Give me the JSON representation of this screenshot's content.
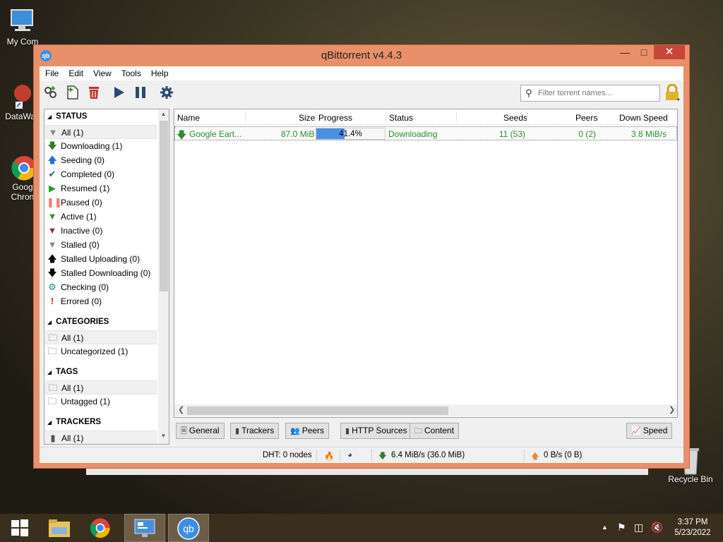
{
  "desktop": {
    "icons": [
      {
        "label": "My Computer",
        "visible": "My Com"
      },
      {
        "label": "DataWag",
        "visible": "DataWag"
      },
      {
        "label": "Google Chrome",
        "visible_line1": "Goog",
        "visible_line2": "Chron"
      },
      {
        "label": "Recycle Bin"
      }
    ]
  },
  "window": {
    "title": "qBittorrent v4.4.3",
    "app_icon_text": "qb",
    "controls": {
      "minimize": "🗕",
      "maximize": "🗖",
      "close": "✕"
    }
  },
  "menu": [
    "File",
    "Edit",
    "View",
    "Tools",
    "Help"
  ],
  "toolbar": {
    "search_placeholder": "Filter torrent names...",
    "icons": [
      "add-torrent-link-icon",
      "add-torrent-file-icon",
      "delete-icon",
      "resume-icon",
      "pause-icon",
      "options-gear-icon"
    ]
  },
  "sidebar": {
    "status_header": "STATUS",
    "status": [
      {
        "label": "All (1)",
        "icon": "funnel",
        "color": "#888888"
      },
      {
        "label": "Downloading (1)",
        "icon": "arrow-down",
        "color": "#2e7d32"
      },
      {
        "label": "Seeding (0)",
        "icon": "arrow-up",
        "color": "#1e6ed8"
      },
      {
        "label": "Completed (0)",
        "icon": "check",
        "color": "#355a7a"
      },
      {
        "label": "Resumed (1)",
        "icon": "play",
        "color": "#2e9e2e"
      },
      {
        "label": "Paused (0)",
        "icon": "pause",
        "color": "#f08070"
      },
      {
        "label": "Active (1)",
        "icon": "funnel",
        "color": "#3a8a3a"
      },
      {
        "label": "Inactive (0)",
        "icon": "funnel",
        "color": "#8a3a3a"
      },
      {
        "label": "Stalled (0)",
        "icon": "funnel",
        "color": "#888888"
      },
      {
        "label": "Stalled Uploading (0)",
        "icon": "arrow-up",
        "color": "#000000"
      },
      {
        "label": "Stalled Downloading (0)",
        "icon": "arrow-down",
        "color": "#000000"
      },
      {
        "label": "Checking (0)",
        "icon": "gear",
        "color": "#1a8a8a"
      },
      {
        "label": "Errored (0)",
        "icon": "exclaim",
        "color": "#e02020"
      }
    ],
    "categories_header": "CATEGORIES",
    "categories": [
      "All (1)",
      "Uncategorized (1)"
    ],
    "tags_header": "TAGS",
    "tags": [
      "All (1)",
      "Untagged (1)"
    ],
    "trackers_header": "TRACKERS",
    "trackers": [
      "All (1)"
    ]
  },
  "list": {
    "columns": [
      "Name",
      "Size",
      "Progress",
      "Status",
      "Seeds",
      "Peers",
      "Down Speed"
    ],
    "rows": [
      {
        "name": "Google Eart...",
        "size": "87.0 MiB",
        "progress_text": "41.4%",
        "progress": 0.414,
        "status": "Downloading",
        "seeds": "11 (53)",
        "peers": "0 (2)",
        "down_speed": "3.8 MiB/s"
      }
    ]
  },
  "tabs": [
    "General",
    "Trackers",
    "Peers",
    "HTTP Sources",
    "Content"
  ],
  "speed_button": "Speed",
  "statusbar": {
    "dht": "DHT: 0 nodes",
    "download": "6.4 MiB/s (36.0 MiB)",
    "upload": "0 B/s (0 B)"
  },
  "colors": {
    "window_frame": "#e9906a",
    "close_button": "#c7463b",
    "downloading_green": "#2e8b2e",
    "progress_blue": "#4a90e2"
  },
  "taskbar": {
    "time": "3:37 PM",
    "date": "5/23/2022"
  }
}
